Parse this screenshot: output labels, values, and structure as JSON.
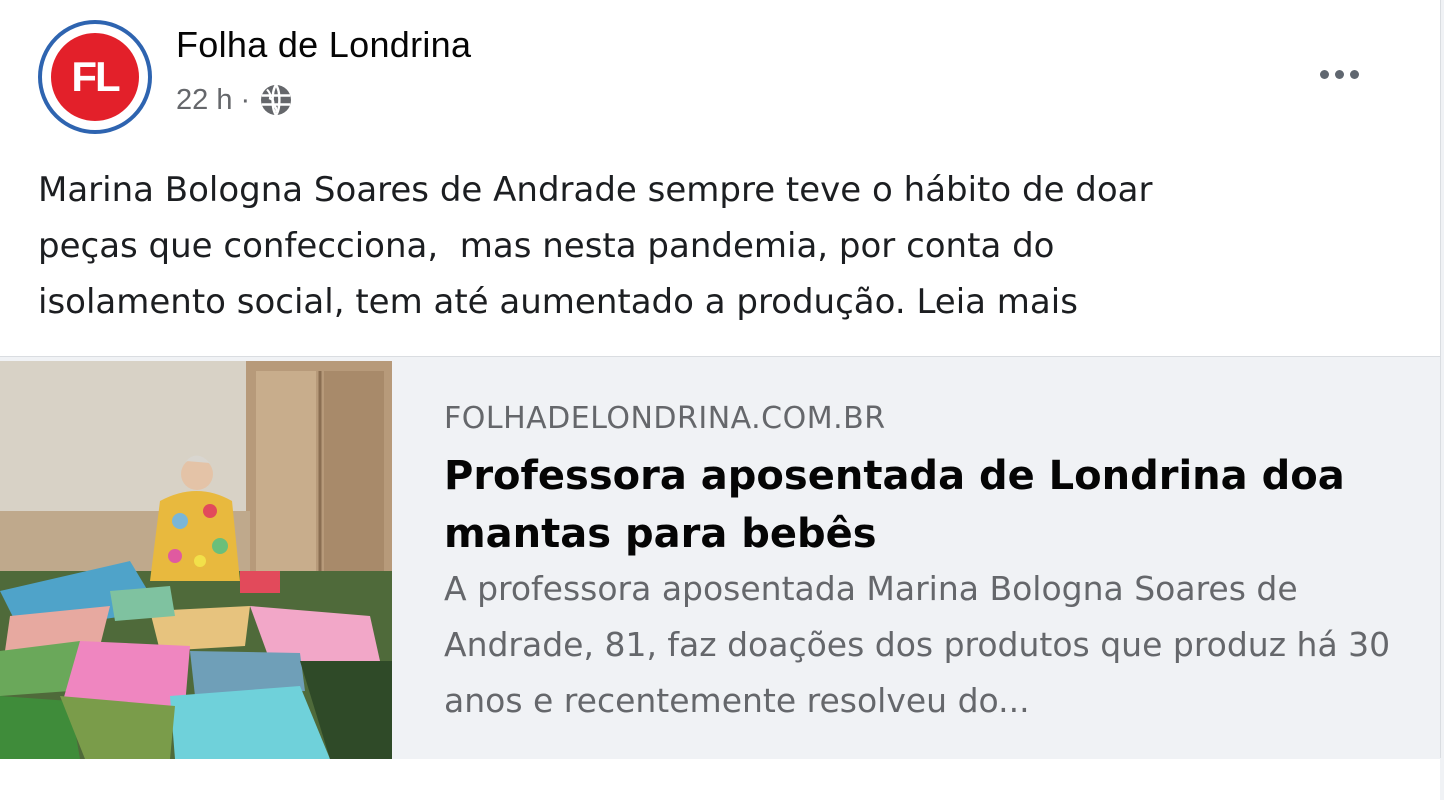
{
  "post": {
    "page_name": "Folha de Londrina",
    "avatar_initials": "FL",
    "timestamp": "22 h",
    "separator": "·",
    "privacy_icon": "globe-icon",
    "more_icon": "more-options-icon",
    "text": "Marina Bologna Soares de Andrade sempre teve o hábito de doar\npeças que confecciona,  mas nesta pandemia, por conta do\nisolamento social, tem até aumentado a produção. Leia mais"
  },
  "link_preview": {
    "domain": "FOLHADELONDRINA.COM.BR",
    "title": "Professora aposentada de Londrina doa mantas para bebês",
    "description": "A professora aposentada Marina Bologna Soares de Andrade, 81, faz doações dos produtos que produz há 30 anos e recentemente resolveu do..."
  },
  "colors": {
    "brand_red": "#e3202a",
    "brand_blue": "#2e64b0",
    "secondary_text": "#65676b",
    "preview_bg": "#f0f2f5"
  }
}
